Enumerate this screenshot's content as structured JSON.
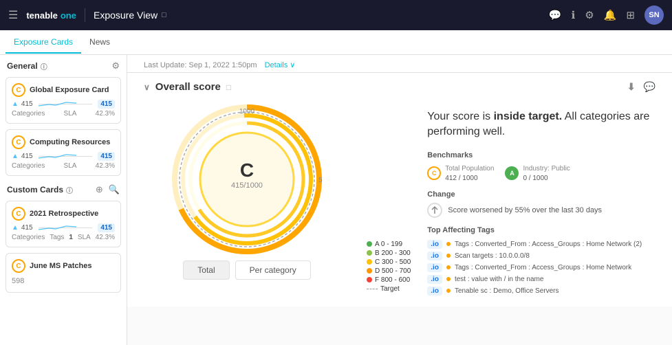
{
  "nav": {
    "logo": "tenable",
    "logo_one": "one",
    "title": "Exposure View",
    "title_icon": "□",
    "hamburger": "☰",
    "avatar": "SN",
    "icons": [
      "💬",
      "ℹ",
      "⚙",
      "🔔",
      "⊞"
    ]
  },
  "sub_tabs": [
    {
      "label": "Exposure Cards",
      "active": true
    },
    {
      "label": "News",
      "active": false
    }
  ],
  "sidebar": {
    "general_title": "General",
    "general_info": "ⓘ",
    "gear_icon": "⚙",
    "general_cards": [
      {
        "grade": "C",
        "title": "Global Exposure Card",
        "score": "415",
        "score_max": "1000",
        "categories_label": "Categories",
        "sla_label": "SLA",
        "sla_value": "42.3%"
      },
      {
        "grade": "C",
        "title": "Computing Resources",
        "score": "415",
        "score_max": "1000",
        "categories_label": "Categories",
        "sla_label": "SLA",
        "sla_value": "42.3%"
      }
    ],
    "custom_cards_title": "Custom Cards",
    "custom_cards_info": "ⓘ",
    "custom_cards": [
      {
        "grade": "C",
        "title": "2021 Retrospective",
        "score": "415",
        "score_max": "1000",
        "categories_label": "Categories",
        "tags_label": "Tags",
        "tags_value": "1",
        "sla_label": "SLA",
        "sla_value": "42.3%"
      },
      {
        "grade": "C",
        "title": "June MS Patches",
        "score": "598",
        "score_max": "1000",
        "categories_label": "",
        "sla_label": "",
        "sla_value": ""
      }
    ]
  },
  "content": {
    "last_update": "Last Update: Sep 1, 2022 1:50pm",
    "details_link": "Details ∨",
    "overall_score_title": "Overall score",
    "score_headline_pre": "Your score is ",
    "score_headline_bold": "inside target.",
    "score_headline_post": " All categories are performing well.",
    "gauge": {
      "grade": "C",
      "score": "415",
      "max": "1000",
      "display": "C\n415/1000"
    },
    "score_buttons": [
      {
        "label": "Total",
        "active": true
      },
      {
        "label": "Per category",
        "active": false
      }
    ],
    "legend": [
      {
        "color": "#4caf50",
        "label": "A   0 - 199"
      },
      {
        "color": "#8bc34a",
        "label": "B   200 - 300"
      },
      {
        "color": "#ffc107",
        "label": "C   300 - 500"
      },
      {
        "color": "#ff9800",
        "label": "D   500 - 700"
      },
      {
        "color": "#f44336",
        "label": "F   800 - 600"
      },
      {
        "dashed": true,
        "label": "Target"
      }
    ],
    "benchmarks_title": "Benchmarks",
    "benchmarks": [
      {
        "grade": "C",
        "grade_style": "orange",
        "label": "Total Population",
        "value": "412 / 1000"
      },
      {
        "grade": "A",
        "grade_style": "green",
        "label": "Industry: Public",
        "value": "0 / 1000"
      }
    ],
    "change_title": "Change",
    "change_text": "Score worsened by 55% over the last 30 days",
    "affecting_title": "Top Affecting Tags",
    "affecting_items": [
      {
        "tag": ".io",
        "text": "Tags : Converted_From : Access_Groups : Home Network (2)"
      },
      {
        "tag": ".io",
        "text": "Scan targets : 10.0.0.0/8"
      },
      {
        "tag": ".io",
        "text": "Tags : Converted_From : Access_Groups : Home Network"
      },
      {
        "tag": ".io",
        "text": "test : value with / in the name"
      },
      {
        "tag": ".io",
        "text": "Tenable sc : Demo, Office Servers"
      }
    ]
  }
}
